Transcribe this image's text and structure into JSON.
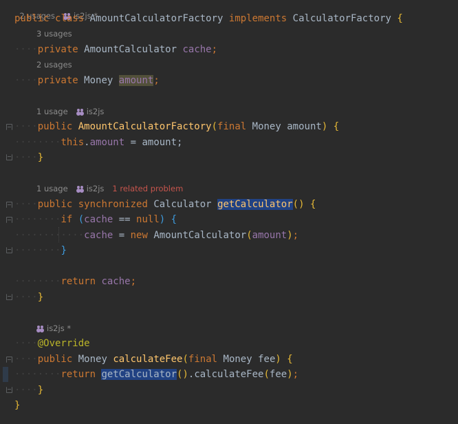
{
  "editor": {
    "class_hint": {
      "usages": "2 usages",
      "author": "is2js *"
    },
    "class_decl": {
      "public": "public",
      "class": "class",
      "name": "AmountCalculatorFactory",
      "implements": "implements",
      "iface": "CalculatorFactory",
      "brace": "{"
    },
    "field1_hint": {
      "usages": "3 usages"
    },
    "field1": {
      "private": "private",
      "type": "AmountCalculator",
      "name": "cache",
      "semi": ";"
    },
    "field2_hint": {
      "usages": "2 usages"
    },
    "field2": {
      "private": "private",
      "type": "Money",
      "name": "amount",
      "semi": ";"
    },
    "ctor_hint": {
      "usages": "1 usage",
      "author": "is2js"
    },
    "ctor": {
      "public": "public",
      "name": "AmountCalculatorFactory",
      "open": "(",
      "final": "final",
      "ptype": "Money",
      "pname": "amount",
      "close": ")",
      "brace": "{"
    },
    "ctor_body": {
      "this": "this",
      "dot": ".",
      "field": "amount",
      "assign": " = amount;"
    },
    "close_brace": "}",
    "getcalc_hint": {
      "usages": "1 usage",
      "author": "is2js",
      "problem": "1 related problem"
    },
    "getcalc": {
      "public": "public",
      "synchronized": "synchronized",
      "rtype": "Calculator",
      "name": "getCalculator",
      "parens": "()",
      "brace": "{"
    },
    "if_line": {
      "if": "if",
      "open": "(",
      "field": "cache",
      "op": " == ",
      "null": "null",
      "close": ")",
      "brace": "{"
    },
    "assign_line": {
      "field": "cache",
      "eq": " = ",
      "new": "new",
      "cls": "AmountCalculator",
      "open": "(",
      "arg": "amount",
      "close": ")",
      "semi": ";"
    },
    "inner_close": "}",
    "return1": {
      "return": "return",
      "field": "cache",
      "semi": ";"
    },
    "fee_hint": {
      "author": "is2js *"
    },
    "override": "@Override",
    "fee_decl": {
      "public": "public",
      "rtype": "Money",
      "name": "calculateFee",
      "open": "(",
      "final": "final",
      "ptype": "Money",
      "pname": "fee",
      "close": ")",
      "brace": "{"
    },
    "return2": {
      "return": "return",
      "call": "getCalculator",
      "parens": "()",
      "rest": ".calculateFee",
      "open": "(",
      "arg": "fee",
      "close": ")",
      "semi": ";"
    },
    "final_brace": "}"
  }
}
